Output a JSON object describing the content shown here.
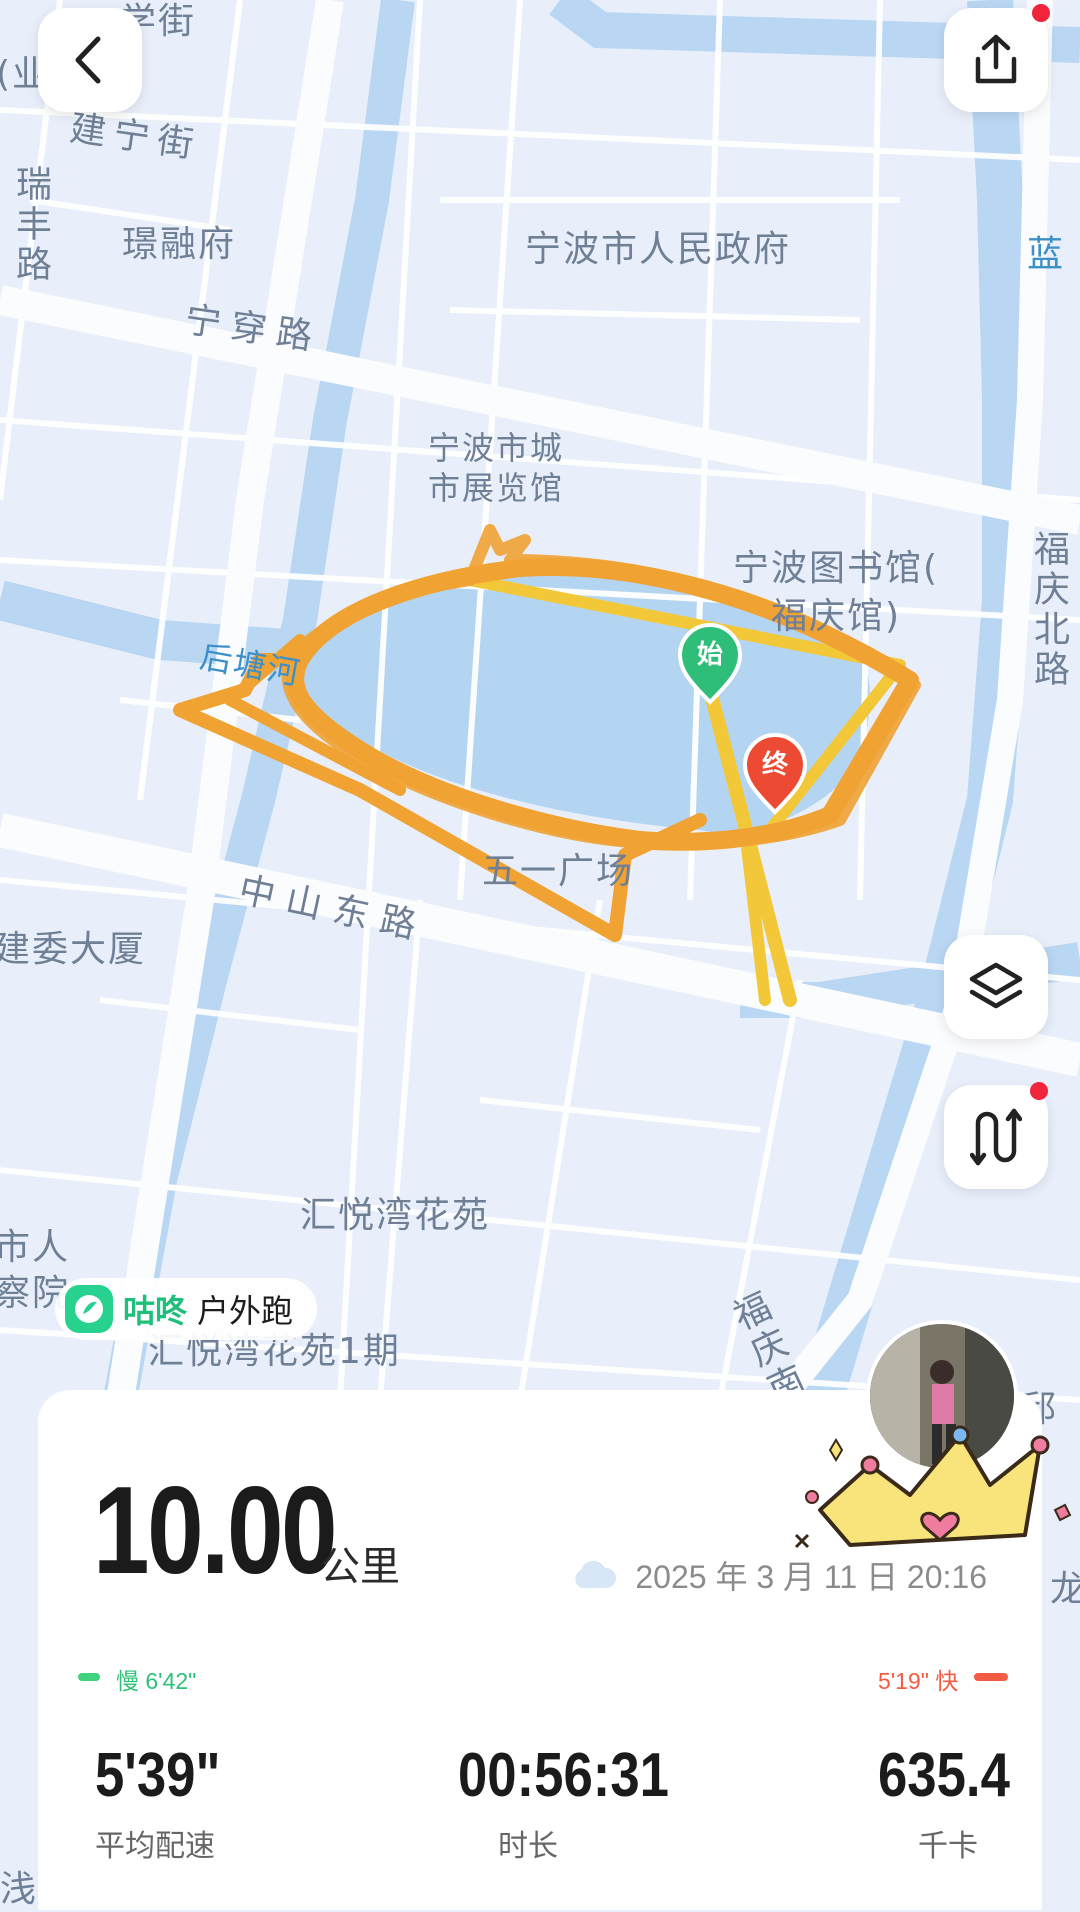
{
  "map": {
    "labels": {
      "street_top": "学街",
      "street_left_cut": "(业",
      "jianning": "建宁街",
      "ruifeng": "瑞丰路",
      "jingrongfu": "璟融府",
      "gov": "宁波市人民政府",
      "lan": "蓝",
      "ningchuan": "宁穿路",
      "exhibit": "宁波市城\n市展览馆",
      "library": "宁波图书馆(\n福庆馆)",
      "fuqing_n": "福庆北路",
      "houtang": "后塘河",
      "wuyi": "五一广场",
      "zhongshan": "中山东路",
      "jianwei": "建委大厦",
      "huiyue": "汇悦湾花苑",
      "city_people": "市人\n察院",
      "huiyue1": "汇悦湾花苑1期",
      "fuqing_s": "福庆南",
      "qiu": "邱",
      "long": "龙",
      "qian": "浅"
    },
    "markers": {
      "start": "始",
      "end": "终"
    },
    "pace_colors": {
      "slow": "#f2c838",
      "fast": "#f0a030"
    }
  },
  "buttons": {
    "back": "back",
    "share": "share",
    "layers": "layers",
    "route": "route"
  },
  "tag": {
    "brand": "咕咚",
    "kind": "户外跑"
  },
  "summary": {
    "distance": "10.00",
    "distance_unit": "公里",
    "datetime": "2025 年 3 月 11 日 20:16",
    "pace_slow_label": "慢 6'42\"",
    "pace_fast_label": "5'19\" 快",
    "stats": [
      {
        "value": "5'39\"",
        "label": "平均配速"
      },
      {
        "value": "00:56:31",
        "label": "时长"
      },
      {
        "value": "635.4",
        "label": "千卡"
      }
    ]
  },
  "colors": {
    "green": "#2fcf8a",
    "red": "#f25c44",
    "orange_route": "#f0a233",
    "yellow_route": "#f2c838"
  }
}
